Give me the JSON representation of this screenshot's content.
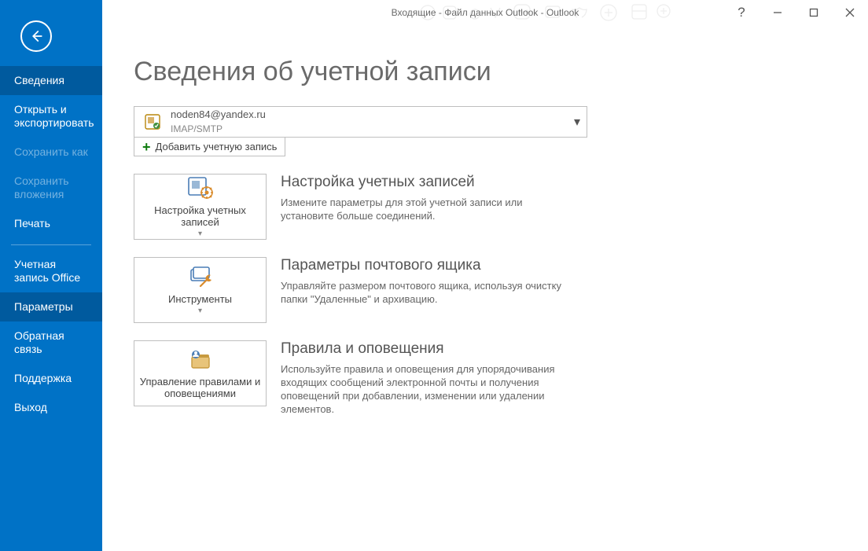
{
  "colors": {
    "primary": "#0072c6",
    "primary_dark": "#005a9e"
  },
  "window": {
    "title": "Входящие - Файл данных Outlook - Outlook"
  },
  "sidebar": {
    "items": [
      {
        "label": "Сведения",
        "state": "selected"
      },
      {
        "label": "Открыть и экспортировать",
        "state": "normal"
      },
      {
        "label": "Сохранить как",
        "state": "disabled"
      },
      {
        "label": "Сохранить вложения",
        "state": "disabled"
      },
      {
        "label": "Печать",
        "state": "normal"
      },
      {
        "label": "Учетная запись Office",
        "state": "normal"
      },
      {
        "label": "Параметры",
        "state": "selected"
      },
      {
        "label": "Обратная связь",
        "state": "normal"
      },
      {
        "label": "Поддержка",
        "state": "normal"
      },
      {
        "label": "Выход",
        "state": "normal"
      }
    ]
  },
  "page": {
    "title": "Сведения об учетной записи",
    "account": {
      "email": "noden84@yandex.ru",
      "protocol": "IMAP/SMTP"
    },
    "add_account_label": "Добавить учетную запись",
    "sections": [
      {
        "tile_label": "Настройка учетных записей",
        "tile_has_caret": true,
        "title": "Настройка учетных записей",
        "desc": "Измените параметры для этой учетной записи или установите больше соединений."
      },
      {
        "tile_label": "Инструменты",
        "tile_has_caret": true,
        "title": "Параметры почтового ящика",
        "desc": "Управляйте размером почтового ящика, используя очистку папки \"Удаленные\" и архивацию."
      },
      {
        "tile_label": "Управление правилами и оповещениями",
        "tile_has_caret": false,
        "title": "Правила и оповещения",
        "desc": "Используйте правила и оповещения для упорядочивания входящих сообщений электронной почты и получения оповещений при добавлении, изменении или удалении элементов."
      }
    ]
  }
}
